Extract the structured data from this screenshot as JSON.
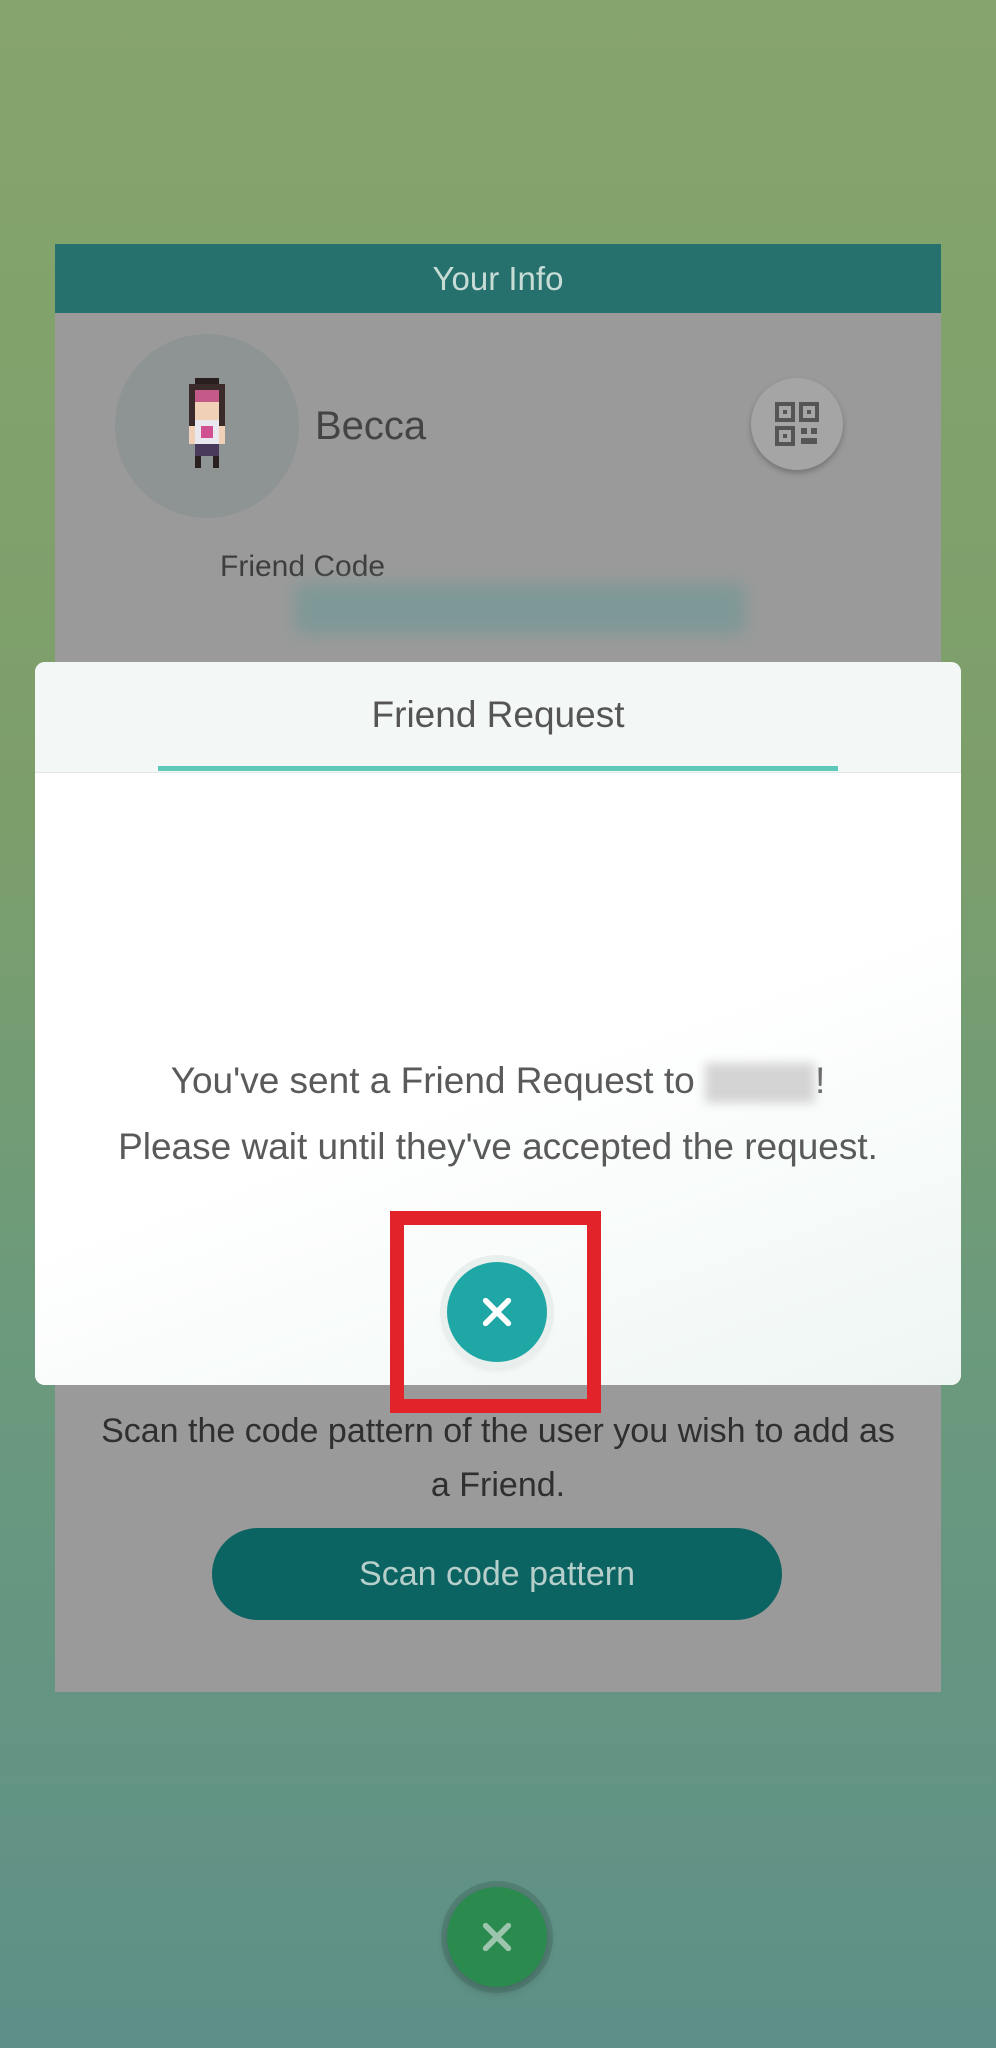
{
  "background_card": {
    "header_title": "Your Info",
    "player_name": "Becca",
    "friend_code_label": "Friend Code",
    "friend_code_value": "",
    "scan_instructions": "Scan the code pattern of the user you wish to add as a Friend.",
    "scan_button_label": "Scan code pattern"
  },
  "modal": {
    "title": "Friend Request",
    "message_prefix": "You've sent a Friend Request to ",
    "message_suffix": "!",
    "message_line2": "Please wait until they've accepted the request."
  },
  "icons": {
    "avatar": "trainer-sprite-icon",
    "qr": "qr-code-icon",
    "close": "close-icon"
  },
  "colors": {
    "header_teal": "#26716e",
    "accent_teal": "#1fa7a6",
    "highlight_red": "#e3232a",
    "bottom_close_green": "#2b8a4e"
  }
}
